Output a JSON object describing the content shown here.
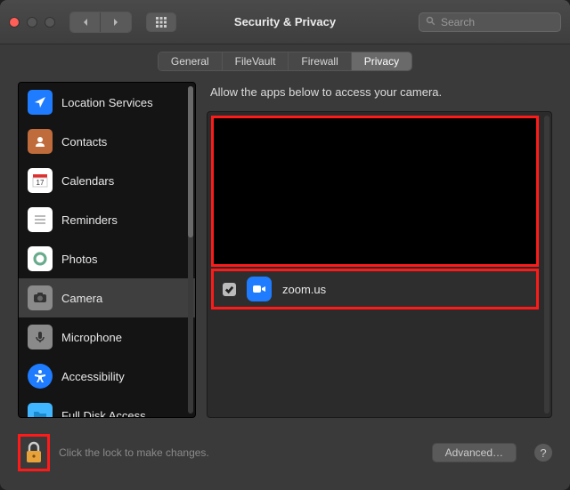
{
  "window": {
    "title": "Security & Privacy"
  },
  "search": {
    "placeholder": "Search"
  },
  "tabs": [
    {
      "label": "General"
    },
    {
      "label": "FileVault"
    },
    {
      "label": "Firewall"
    },
    {
      "label": "Privacy",
      "active": true
    }
  ],
  "sidebar": {
    "items": [
      {
        "label": "Location Services",
        "icon": "location",
        "bg": "#1f7cff"
      },
      {
        "label": "Contacts",
        "icon": "contacts",
        "bg": "#bf6b3b"
      },
      {
        "label": "Calendars",
        "icon": "calendar",
        "bg": "#ffffff"
      },
      {
        "label": "Reminders",
        "icon": "reminders",
        "bg": "#ffffff"
      },
      {
        "label": "Photos",
        "icon": "photos",
        "bg": "#ffffff"
      },
      {
        "label": "Camera",
        "icon": "camera",
        "bg": "#8a8a8a",
        "active": true
      },
      {
        "label": "Microphone",
        "icon": "mic",
        "bg": "#8a8a8a"
      },
      {
        "label": "Accessibility",
        "icon": "access",
        "bg": "#1f7cff"
      },
      {
        "label": "Full Disk Access",
        "icon": "folder",
        "bg": "#3fb6ff"
      }
    ]
  },
  "content": {
    "prompt": "Allow the apps below to access your camera.",
    "apps": [
      {
        "name": "zoom.us",
        "checked": true
      }
    ]
  },
  "footer": {
    "lock_text": "Click the lock to make changes.",
    "advanced_label": "Advanced…"
  }
}
